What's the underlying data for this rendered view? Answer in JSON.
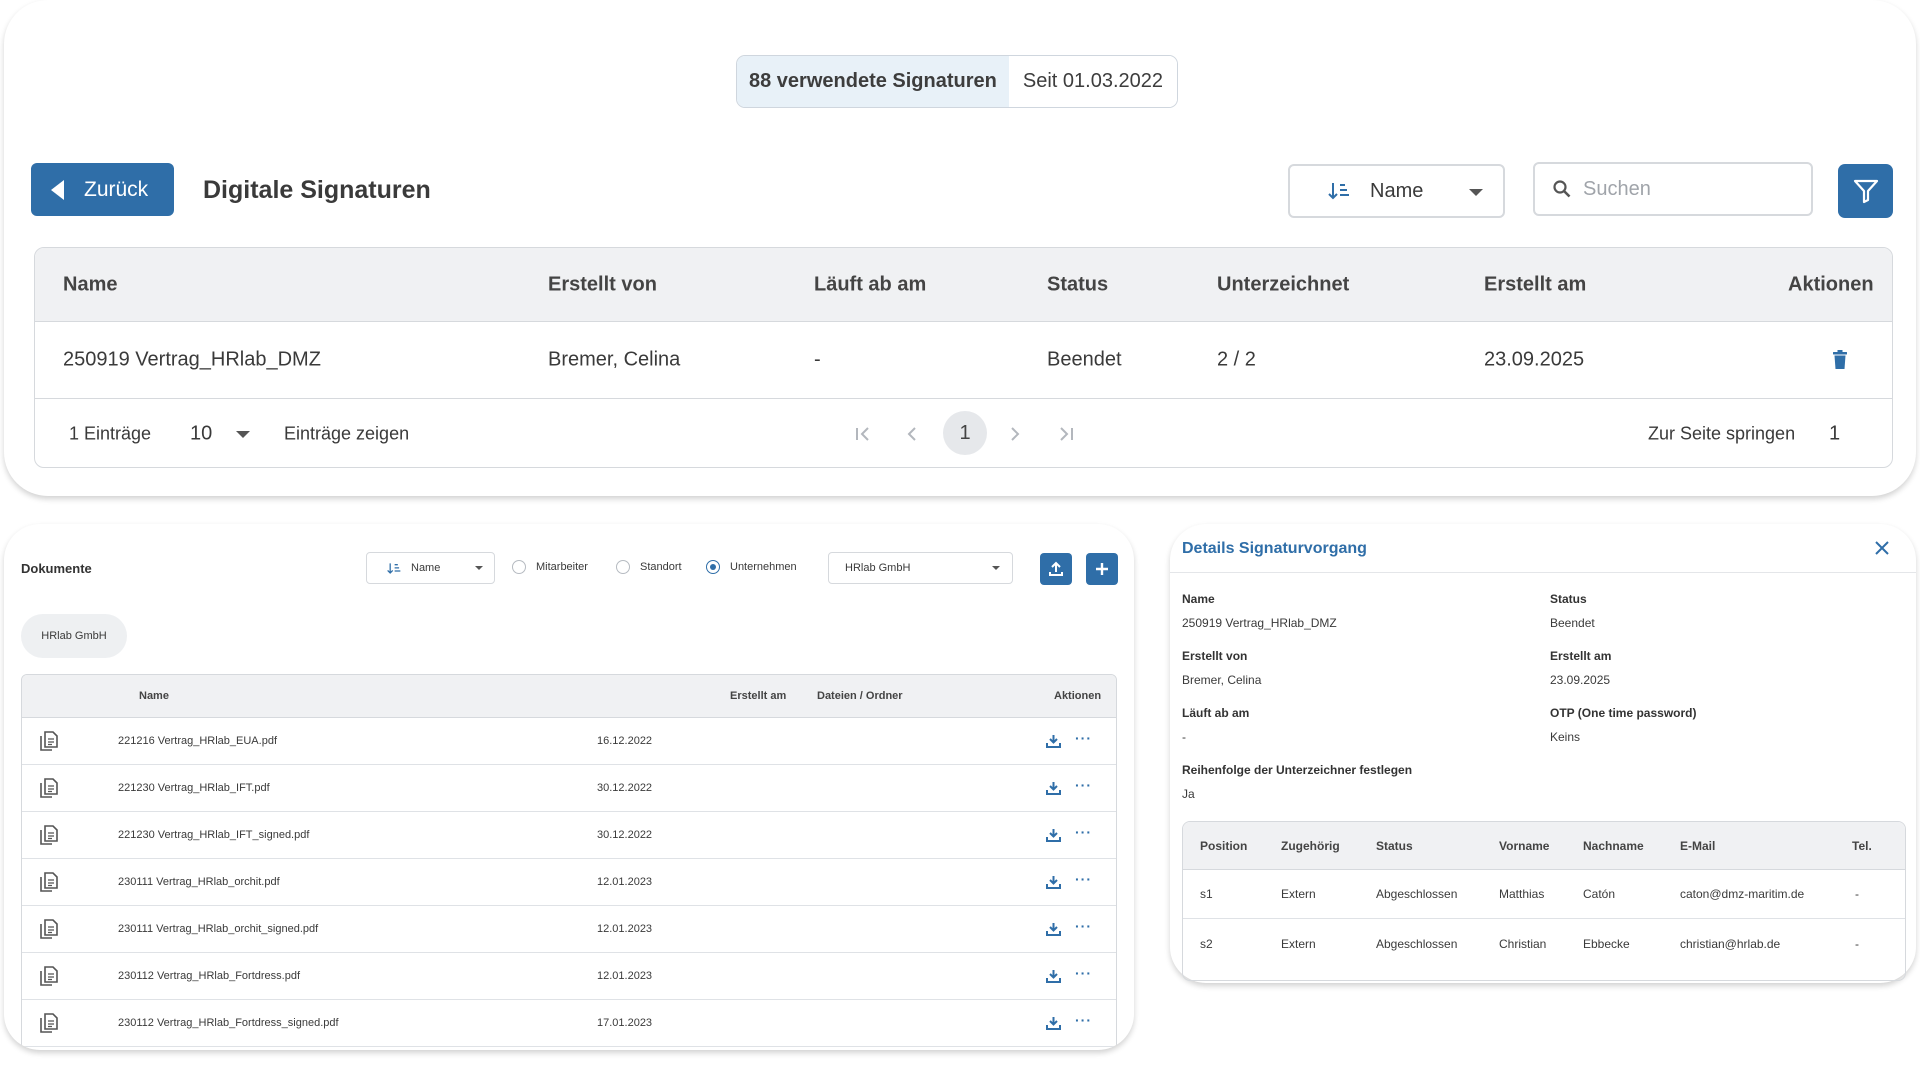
{
  "summary": {
    "count_label": "88 verwendete Signaturen",
    "since_label": "Seit 01.03.2022"
  },
  "toolbar": {
    "back_label": "Zurück",
    "page_title": "Digitale Signaturen",
    "sort_value": "Name",
    "search_placeholder": "Suchen",
    "filter_icon": "filter-icon"
  },
  "main_table": {
    "columns": [
      "Name",
      "Erstellt von",
      "Läuft ab am",
      "Status",
      "Unterzeichnet",
      "Erstellt am",
      "Aktionen"
    ],
    "rows": [
      {
        "name": "250919 Vertrag_HRlab_DMZ",
        "created_by": "Bremer, Celina",
        "expires": "-",
        "status": "Beendet",
        "signed": "2 / 2",
        "created_at": "23.09.2025",
        "action_icon": "trash-icon"
      }
    ],
    "footer": {
      "entries_count": "1 Einträge",
      "page_size": "10",
      "show_entries": "Einträge zeigen",
      "current_page": "1",
      "jump_label": "Zur Seite springen",
      "jump_value": "1"
    }
  },
  "documents": {
    "title": "Dokumente",
    "sort_value": "Name",
    "radios": [
      {
        "label": "Mitarbeiter",
        "selected": false
      },
      {
        "label": "Standort",
        "selected": false
      },
      {
        "label": "Unternehmen",
        "selected": true
      }
    ],
    "company_value": "HRlab GmbH",
    "chip": "HRlab GmbH",
    "columns": [
      "Name",
      "Erstellt am",
      "Dateien / Ordner",
      "Aktionen"
    ],
    "rows": [
      {
        "name": "221216 Vertrag_HRlab_EUA.pdf",
        "created": "16.12.2022"
      },
      {
        "name": "221230 Vertrag_HRlab_IFT.pdf",
        "created": "30.12.2022"
      },
      {
        "name": "221230 Vertrag_HRlab_IFT_signed.pdf",
        "created": "30.12.2022"
      },
      {
        "name": "230111 Vertrag_HRlab_orchit.pdf",
        "created": "12.01.2023"
      },
      {
        "name": "230111 Vertrag_HRlab_orchit_signed.pdf",
        "created": "12.01.2023"
      },
      {
        "name": "230112 Vertrag_HRlab_Fortdress.pdf",
        "created": "12.01.2023"
      },
      {
        "name": "230112 Vertrag_HRlab_Fortdress_signed.pdf",
        "created": "17.01.2023"
      }
    ],
    "more_symbol": "···"
  },
  "details": {
    "title": "Details Signaturvorgang",
    "fields": {
      "name_label": "Name",
      "name_value": "250919 Vertrag_HRlab_DMZ",
      "status_label": "Status",
      "status_value": "Beendet",
      "created_by_label": "Erstellt von",
      "created_by_value": "Bremer, Celina",
      "created_at_label": "Erstellt am",
      "created_at_value": "23.09.2025",
      "expires_label": "Läuft ab am",
      "expires_value": "-",
      "otp_label": "OTP (One time password)",
      "otp_value": "Keins",
      "order_label": "Reihenfolge der Unterzeichner festlegen",
      "order_value": "Ja"
    },
    "columns": [
      "Position",
      "Zugehörig",
      "Status",
      "Vorname",
      "Nachname",
      "E-Mail",
      "Tel."
    ],
    "rows": [
      {
        "position": "s1",
        "belongs": "Extern",
        "status": "Abgeschlossen",
        "first": "Matthias",
        "last": "Catón",
        "email": "caton@dmz-maritim.de",
        "tel": "-"
      },
      {
        "position": "s2",
        "belongs": "Extern",
        "status": "Abgeschlossen",
        "first": "Christian",
        "last": "Ebbecke",
        "email": "christian@hrlab.de",
        "tel": "-"
      }
    ]
  },
  "colors": {
    "accent": "#2f6ea8",
    "summary_bg": "#e8f1f8",
    "table_header_bg": "#f0f1f3"
  }
}
